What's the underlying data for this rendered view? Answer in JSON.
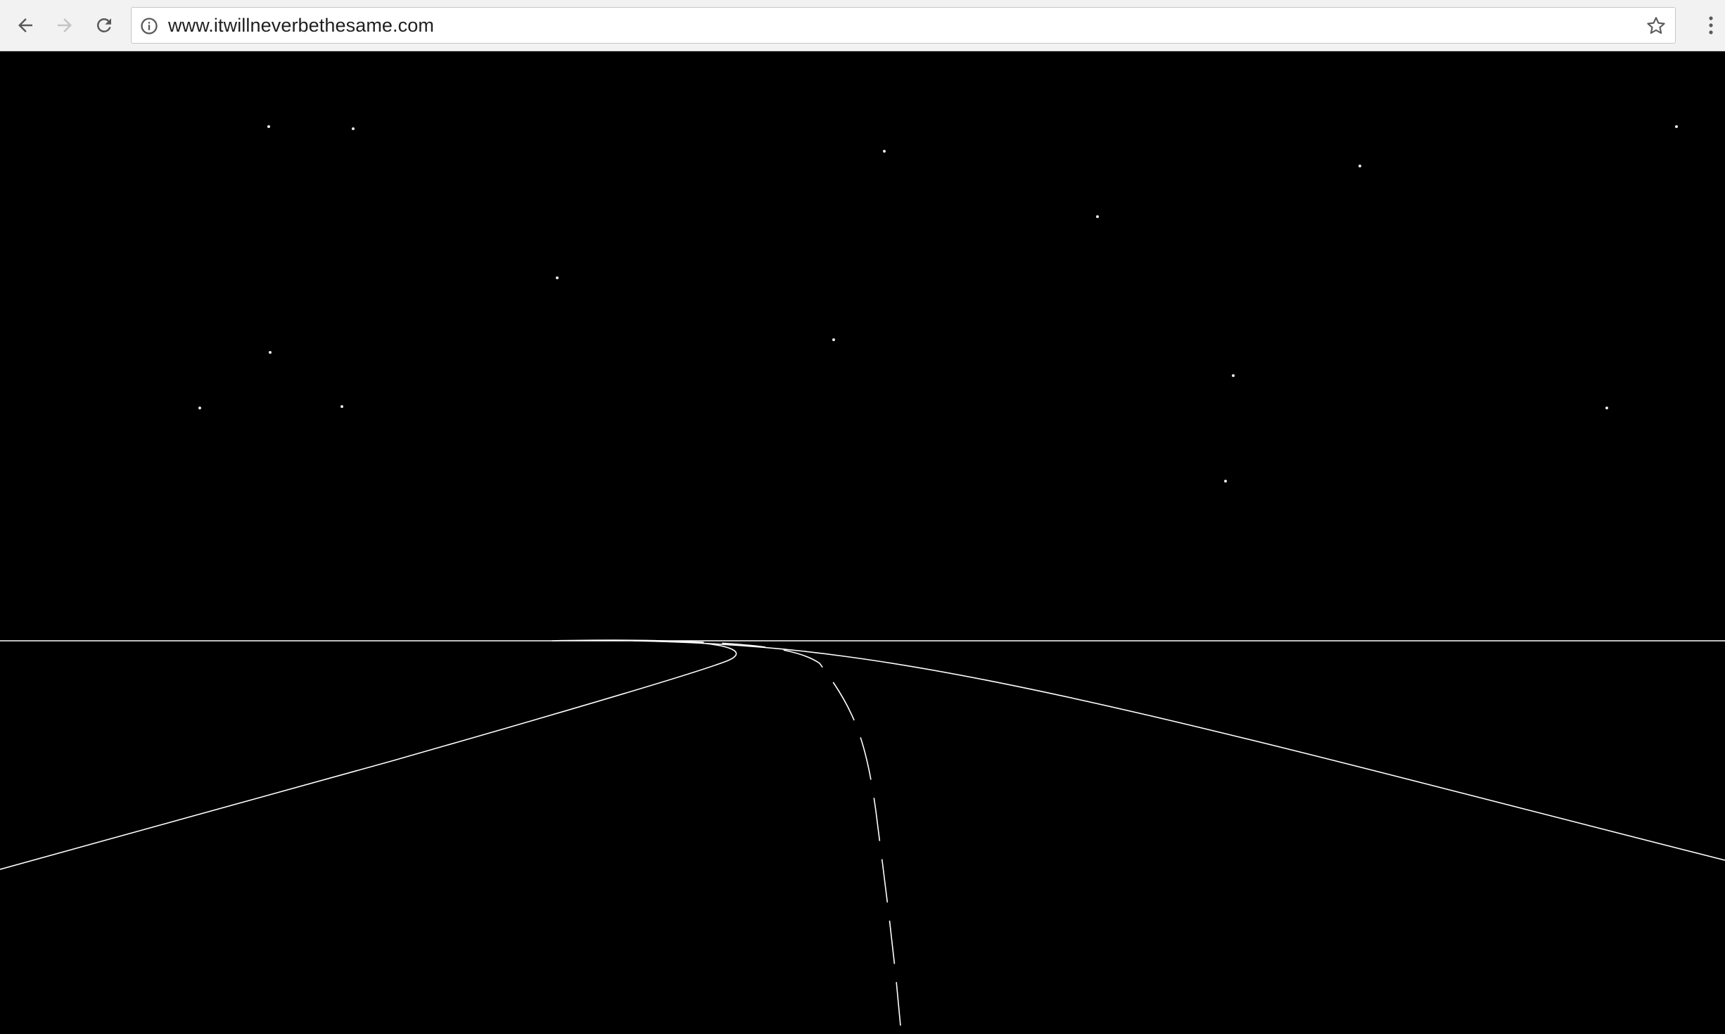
{
  "browser": {
    "url": "www.itwillneverbethesame.com",
    "icons": {
      "back": "back-arrow-icon",
      "forward": "forward-arrow-icon",
      "reload": "reload-icon",
      "info": "info-icon",
      "bookmark": "star-icon",
      "menu": "kebab-menu-icon"
    },
    "forward_enabled": false
  },
  "scene": {
    "background": "#000000",
    "line_color": "#ffffff",
    "star_count": 14
  }
}
